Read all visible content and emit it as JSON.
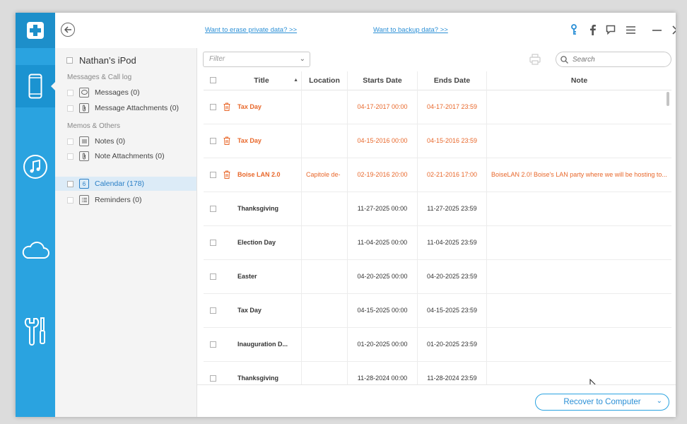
{
  "top_links": {
    "erase": "Want to erase private data? >>",
    "backup": "Want to backup data? >>"
  },
  "sidebar": {
    "device": "Nathan’s iPod",
    "groups": [
      {
        "title": "Messages & Call log",
        "items": [
          {
            "label": "Messages (0)",
            "icon": "messages-icon",
            "selected": false
          },
          {
            "label": "Message Attachments (0)",
            "icon": "attachment-icon",
            "selected": false
          }
        ]
      },
      {
        "title": "Memos & Others",
        "items": [
          {
            "label": "Notes (0)",
            "icon": "notes-icon",
            "selected": false
          },
          {
            "label": "Note Attachments (0)",
            "icon": "attachment-icon",
            "selected": false
          },
          {
            "label": "Calendar (178)",
            "icon": "calendar-icon",
            "selected": true
          },
          {
            "label": "Reminders (0)",
            "icon": "reminders-icon",
            "selected": false
          }
        ]
      }
    ]
  },
  "toolbar": {
    "filter_placeholder": "Filter",
    "search_placeholder": "Search"
  },
  "table": {
    "headers": [
      "Title",
      "Location",
      "Starts Date",
      "Ends Date",
      "Note"
    ],
    "rows": [
      {
        "title": "Tax Day",
        "location": "",
        "start": "04-17-2017 00:00",
        "end": "04-17-2017 23:59",
        "note": "",
        "deleted": true
      },
      {
        "title": "Tax Day",
        "location": "",
        "start": "04-15-2016 00:00",
        "end": "04-15-2016 23:59",
        "note": "",
        "deleted": true
      },
      {
        "title": "Boise LAN 2.0",
        "location": "Capitole de-",
        "start": "02-19-2016 20:00",
        "end": "02-21-2016 17:00",
        "note": "BoiseLAN 2.0! Boise's LAN party where we will be hosting to...",
        "deleted": true
      },
      {
        "title": "Thanksgiving",
        "location": "",
        "start": "11-27-2025 00:00",
        "end": "11-27-2025 23:59",
        "note": "",
        "deleted": false
      },
      {
        "title": "Election Day",
        "location": "",
        "start": "11-04-2025 00:00",
        "end": "11-04-2025 23:59",
        "note": "",
        "deleted": false
      },
      {
        "title": "Easter",
        "location": "",
        "start": "04-20-2025 00:00",
        "end": "04-20-2025 23:59",
        "note": "",
        "deleted": false
      },
      {
        "title": "Tax Day",
        "location": "",
        "start": "04-15-2025 00:00",
        "end": "04-15-2025 23:59",
        "note": "",
        "deleted": false
      },
      {
        "title": "Inauguration D...",
        "location": "",
        "start": "01-20-2025 00:00",
        "end": "01-20-2025 23:59",
        "note": "",
        "deleted": false
      },
      {
        "title": "Thanksgiving",
        "location": "",
        "start": "11-28-2024 00:00",
        "end": "11-28-2024 23:59",
        "note": "",
        "deleted": false
      }
    ]
  },
  "footer": {
    "recover_label": "Recover to Computer"
  },
  "colors": {
    "rail": "#2aa3e0",
    "accent": "#2a8fd6",
    "deleted_text": "#e8672a"
  }
}
